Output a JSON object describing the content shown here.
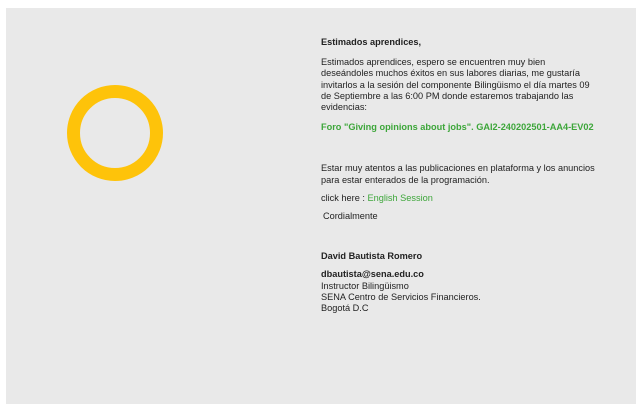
{
  "colors": {
    "panel_bg": "#e9e9e9",
    "ring": "#fec30a",
    "accent": "#3da63a"
  },
  "icons": {
    "decorative_ring": "yellow-ring-icon"
  },
  "message": {
    "greeting": "Estimados aprendices,",
    "body": "Estimados aprendices, espero se encuentren muy bien deseándoles muchos éxitos en sus labores diarias, me gustaría invitarlos a la  sesión del componente Bilingüismo el día martes 09 de Septiembre a las 6:00 PM donde estaremos trabajando las evidencias:",
    "forum_title": "Foro \"Giving opinions about jobs\". GAI2-240202501-AA4-EV02",
    "notice": "Estar muy atentos a las publicaciones en plataforma y los anuncios para estar enterados de la programación.",
    "click_prefix": "click here : ",
    "link_label": "English Session",
    "closing": "Cordialmente"
  },
  "signature": {
    "name": "David Bautista Romero",
    "email": "dbautista@sena.edu.co",
    "role": "Instructor Bilingüismo",
    "organization": "SENA Centro de Servicios Financieros.",
    "city": "Bogotá D.C"
  }
}
